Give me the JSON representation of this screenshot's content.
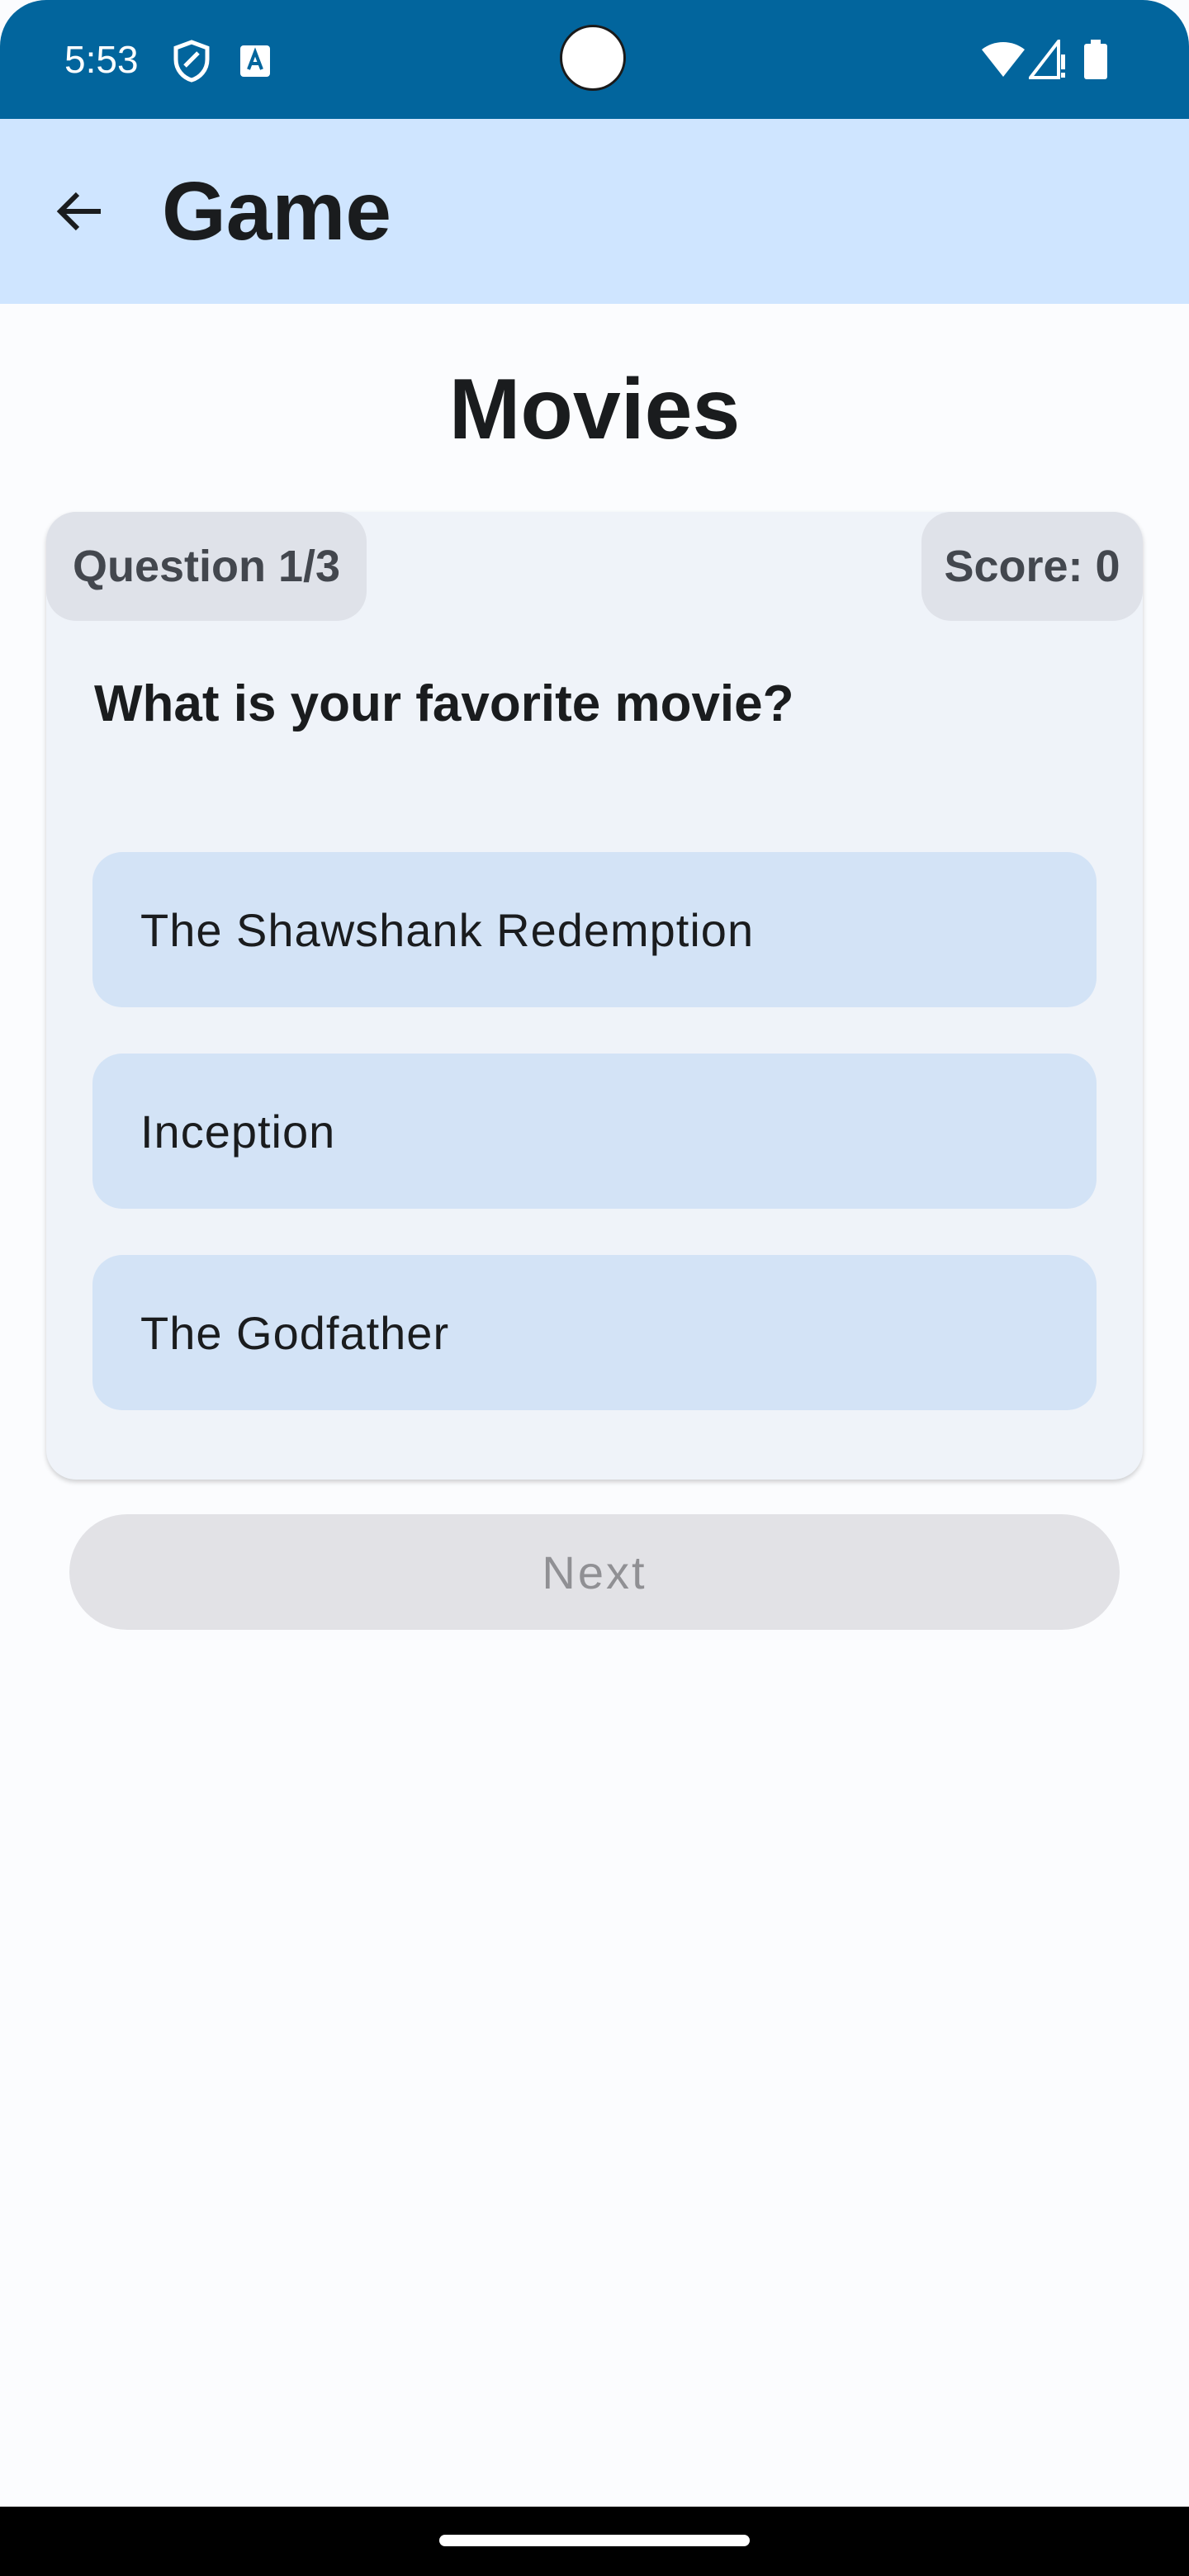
{
  "status_bar": {
    "time": "5:53",
    "background_color": "#02659d",
    "icons": [
      "shield-icon",
      "accessibility-a-icon",
      "wifi-icon",
      "signal-icon",
      "battery-icon"
    ]
  },
  "app_bar": {
    "back_icon": "arrow-back-icon",
    "title": "Game",
    "background_color": "#cfe5ff"
  },
  "quiz": {
    "category": "Movies",
    "progress_label": "Question 1/3",
    "score_label": "Score: 0",
    "question": "What is your favorite movie?",
    "options": [
      {
        "label": "The Shawshank Redemption"
      },
      {
        "label": "Inception"
      },
      {
        "label": "The Godfather"
      }
    ],
    "next_label": "Next",
    "next_enabled": false
  }
}
